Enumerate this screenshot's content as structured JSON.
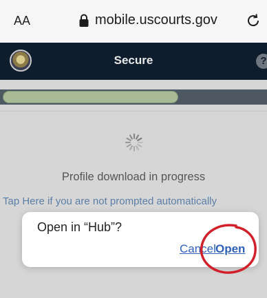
{
  "browser": {
    "text_size_label": "AA",
    "url": "mobile.uscourts.gov",
    "icons": [
      "lock-icon",
      "reload-icon"
    ]
  },
  "header": {
    "title": "Secure",
    "help_label": "?",
    "icons": [
      "seal-icon",
      "help-icon"
    ],
    "background": "#0d1d2d"
  },
  "page": {
    "progress": 0.67,
    "status_text": "Profile download in progress",
    "tap_link": "Tap Here if you are not prompted automatically"
  },
  "dialog": {
    "title": "Open in “Hub”?",
    "cancel_label": "Cancel",
    "open_label": "Open"
  },
  "colors": {
    "accent": "#2f61b8",
    "progress_fill": "#a9bb96",
    "annotation": "#d2202a"
  }
}
